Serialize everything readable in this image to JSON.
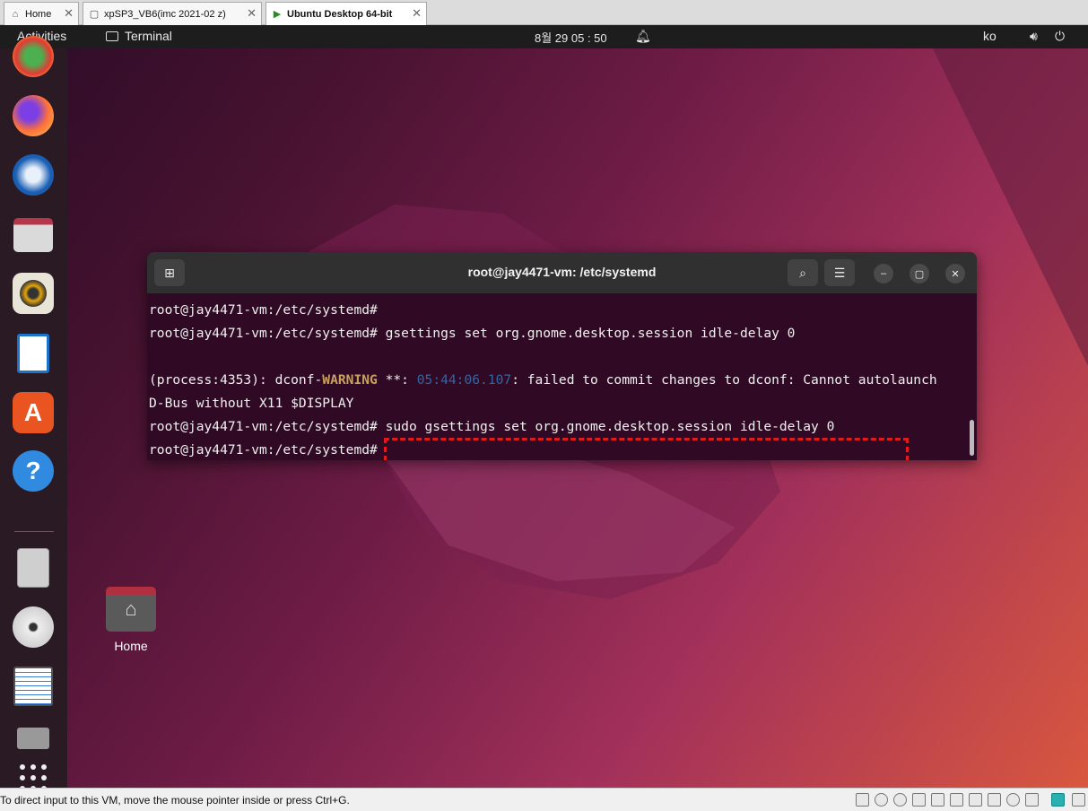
{
  "host_tabs": [
    {
      "label": "Home",
      "icon": "home-icon"
    },
    {
      "label": "xpSP3_VB6(imc 2021-02 z)",
      "icon": "vm-icon"
    },
    {
      "label": "Ubuntu Desktop 64-bit",
      "icon": "vm-running-icon"
    }
  ],
  "close_glyph": "✕",
  "topbar": {
    "activities": "Activities",
    "app_name": "Terminal",
    "clock": "8월 29  05 : 50",
    "input_lang": "ko"
  },
  "desktop": {
    "home_label": "Home"
  },
  "terminal": {
    "title": "root@jay4471-vm: /etc/systemd",
    "lines": {
      "l1": "root@jay4471-vm:/etc/systemd#",
      "l2": "root@jay4471-vm:/etc/systemd# gsettings set org.gnome.desktop.session idle-delay 0",
      "l4a": "(process:4353): dconf-",
      "l4warn": "WARNING",
      "l4b": " **: ",
      "l4ts": "05:44:06.107",
      "l4c": ": failed to commit changes to dconf: Cannot autolaunch",
      "l5": "D-Bus without X11 $DISPLAY",
      "l6": "root@jay4471-vm:/etc/systemd# sudo gsettings set org.gnome.desktop.session idle-delay 0",
      "l7": "root@jay4471-vm:/etc/systemd#"
    }
  },
  "status_bar": {
    "message": "To direct input to this VM, move the mouse pointer inside or press Ctrl+G."
  },
  "colors": {
    "highlight": "#e01b1b",
    "terminal_bg": "#300a24"
  }
}
